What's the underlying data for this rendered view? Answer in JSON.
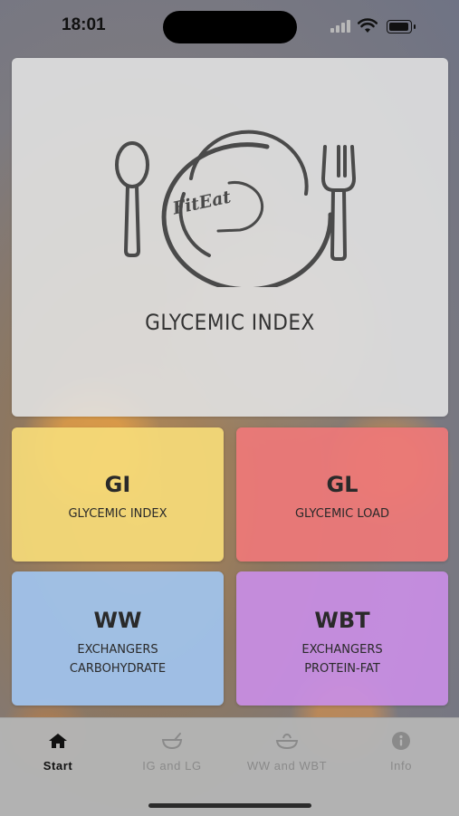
{
  "status_bar": {
    "time": "18:01"
  },
  "hero": {
    "logo_text": "FitEat",
    "title": "GLYCEMIC INDEX"
  },
  "tiles": [
    {
      "abbr": "GI",
      "line1": "GLYCEMIC INDEX",
      "color": "#f5da78"
    },
    {
      "abbr": "GL",
      "line1": "GLYCEMIC LOAD",
      "color": "#ee7878"
    },
    {
      "abbr": "WW",
      "line1": "EXCHANGERS",
      "line2": "CARBOHYDRATE",
      "color": "#a0c4ee"
    },
    {
      "abbr": "WBT",
      "line1": "EXCHANGERS",
      "line2": "PROTEIN-FAT",
      "color": "#c88ee4"
    }
  ],
  "tab_bar": {
    "tabs": [
      {
        "label": "Start",
        "icon": "home-icon",
        "selected": true
      },
      {
        "label": "IG and LG",
        "icon": "bowl-icon",
        "selected": false
      },
      {
        "label": "WW and WBT",
        "icon": "plate-icon",
        "selected": false
      },
      {
        "label": "Info",
        "icon": "info-icon",
        "selected": false
      }
    ]
  }
}
